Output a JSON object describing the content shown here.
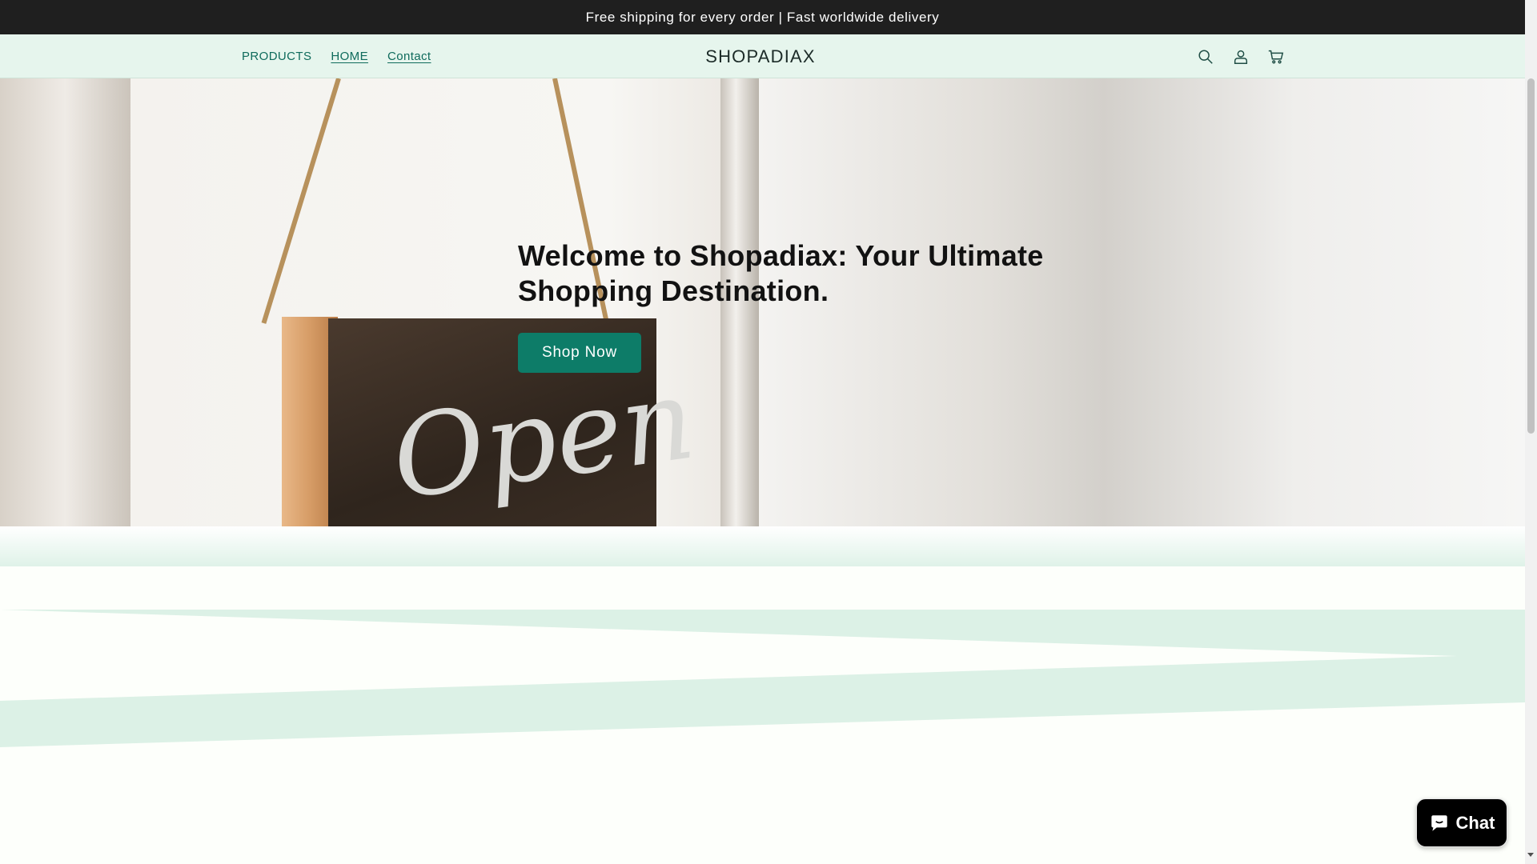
{
  "announcement": {
    "text": "Free shipping for every order | Fast worldwide delivery"
  },
  "header": {
    "nav": [
      {
        "label": "PRODUCTS"
      },
      {
        "label": "HOME"
      },
      {
        "label": "Contact"
      }
    ],
    "logo": "SHOPADIAX",
    "icons": [
      "search-icon",
      "account-icon",
      "cart-icon"
    ]
  },
  "hero": {
    "title": "Welcome to Shopadiax: Your Ultimate Shopping Destination.",
    "button_label": "Shop Now",
    "sign_text": "Open"
  },
  "chat": {
    "label": "Chat"
  },
  "colors": {
    "announcement_bg": "#1f1f1f",
    "header_bg": "#e6f5ed",
    "accent": "#0d7c68",
    "nav_text": "#0f6b5c",
    "stripe": "#dcf1e6"
  }
}
